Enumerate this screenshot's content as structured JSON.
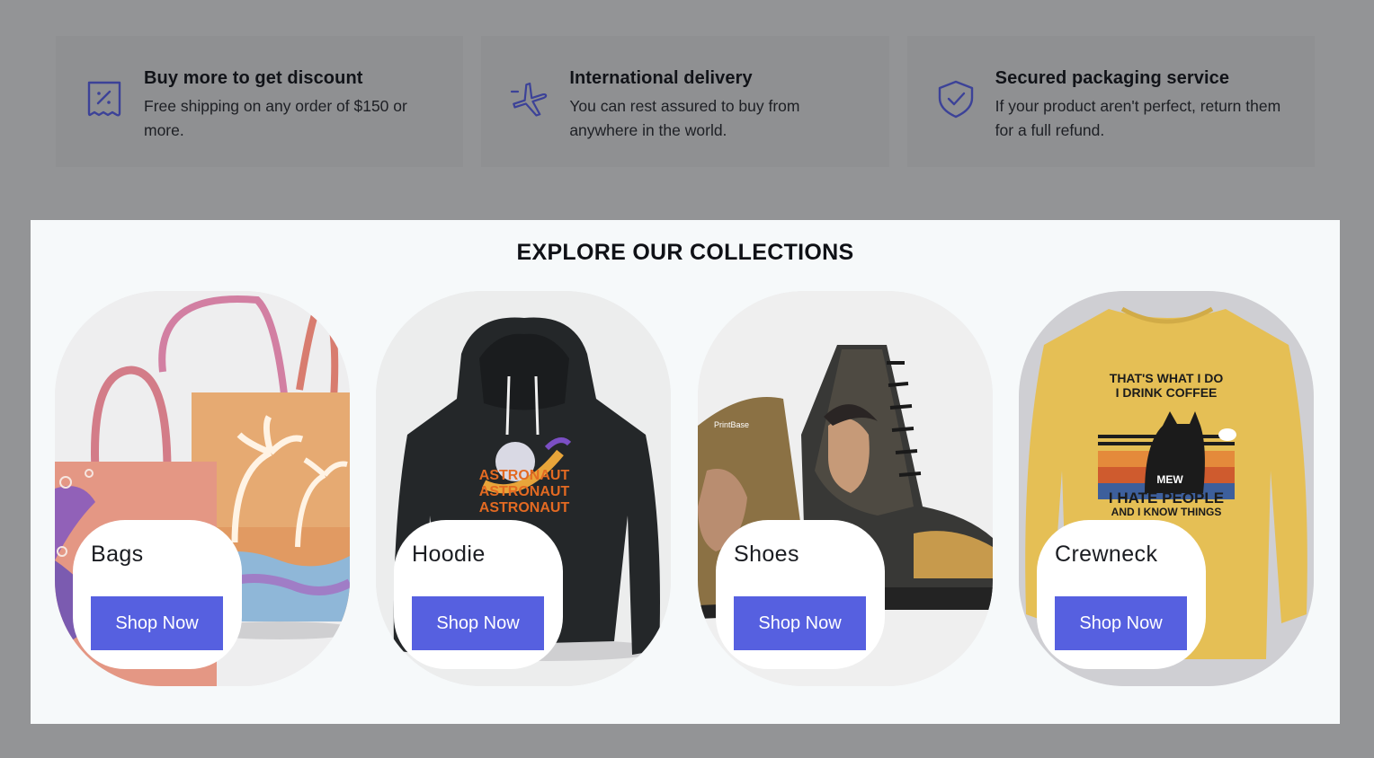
{
  "features": [
    {
      "icon": "discount-receipt-icon",
      "title": "Buy more to get discount",
      "desc": "Free shipping on any order of $150 or more."
    },
    {
      "icon": "airplane-icon",
      "title": "International delivery",
      "desc": "You can rest assured to buy from anywhere in the world."
    },
    {
      "icon": "shield-check-icon",
      "title": "Secured packaging service",
      "desc": "If your product aren't perfect, return them for a full refund."
    }
  ],
  "collections": {
    "title": "EXPLORE OUR COLLECTIONS",
    "items": [
      {
        "label": "Bags",
        "button": "Shop Now",
        "image": "tote-bags-image"
      },
      {
        "label": "Hoodie",
        "button": "Shop Now",
        "image": "astronaut-hoodie-image",
        "print_text": "ASTRONAUT"
      },
      {
        "label": "Shoes",
        "button": "Shop Now",
        "image": "printed-boots-image",
        "brand": "PrintBase"
      },
      {
        "label": "Crewneck",
        "button": "Shop Now",
        "image": "cat-crewneck-image",
        "print_top": "THAT'S WHAT I DO I DRINK COFFEE",
        "print_mid": "MEW",
        "print_bottom": "I HATE PEOPLE AND I KNOW THINGS"
      }
    ]
  },
  "colors": {
    "accent": "#5660e0",
    "overlay": "#939496",
    "panel": "#f6f9fa",
    "icon": "#3c4298"
  }
}
